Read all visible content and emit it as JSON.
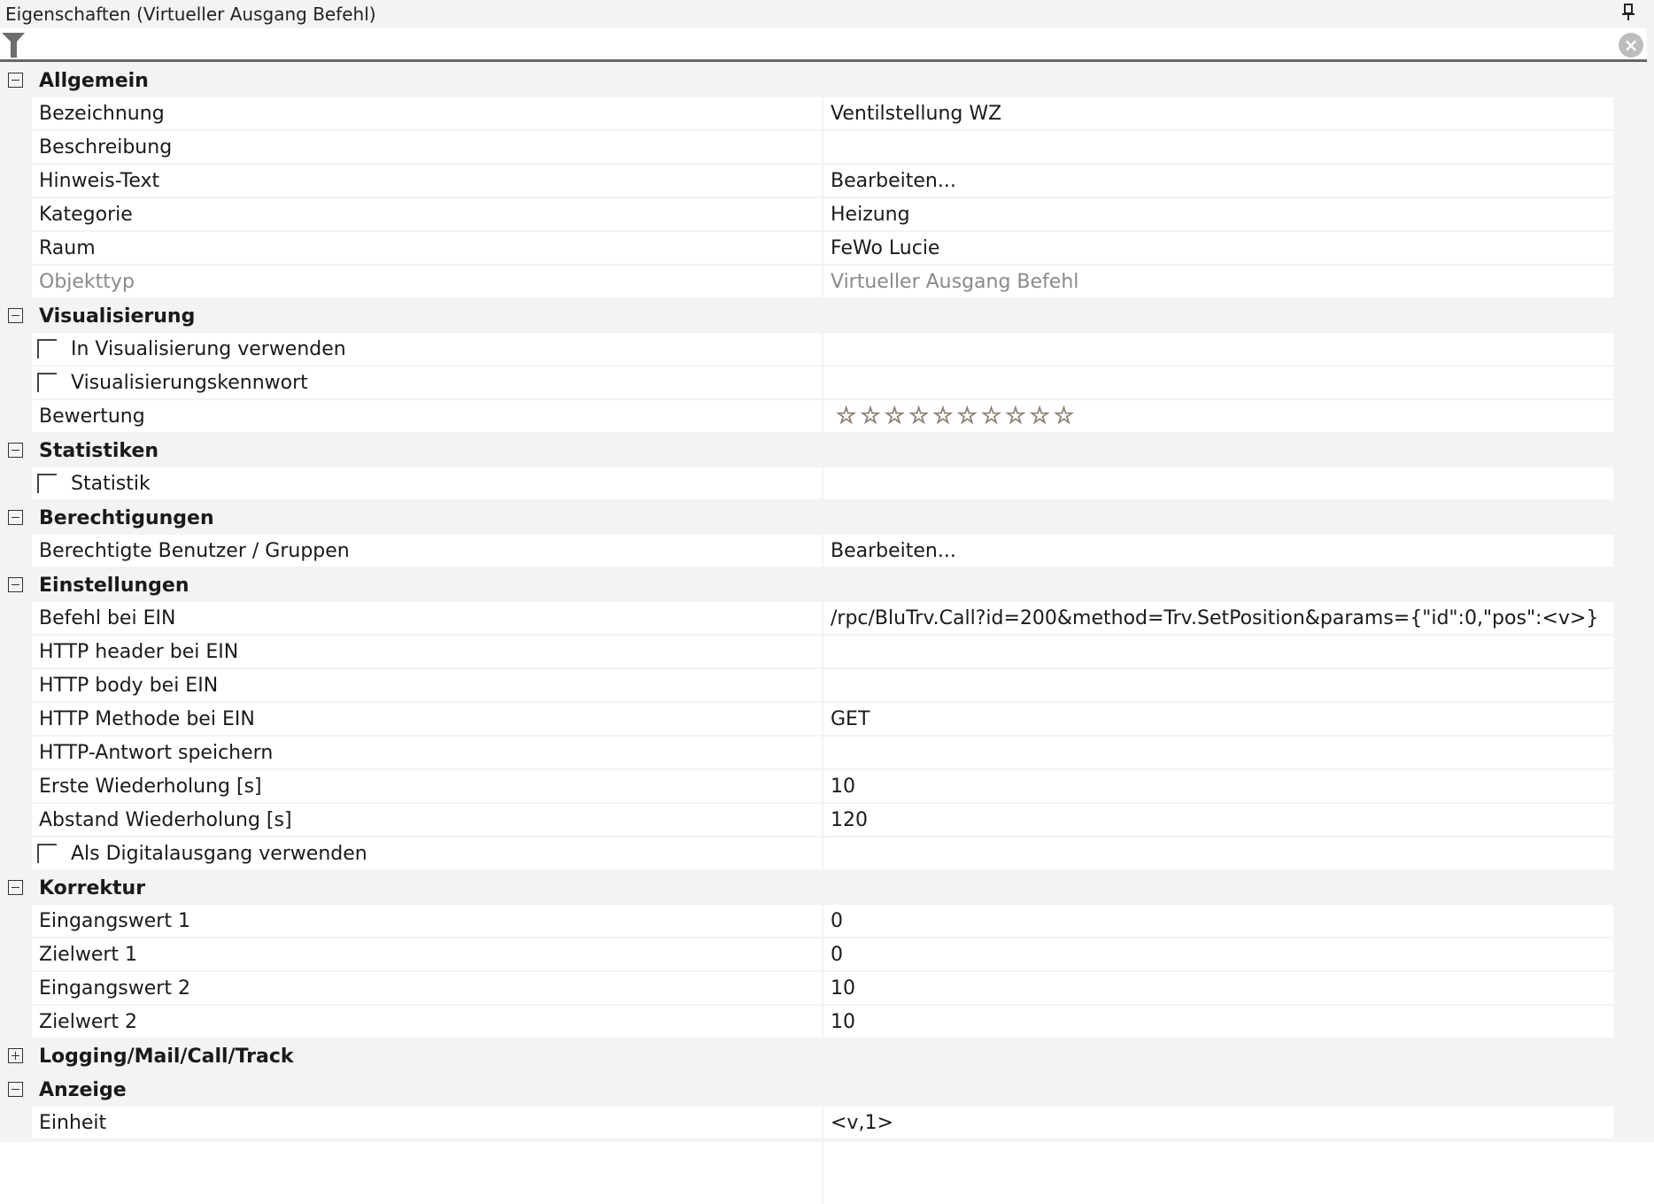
{
  "window": {
    "title": "Eigenschaften (Virtueller Ausgang Befehl)"
  },
  "filter": {
    "value": ""
  },
  "rows": [
    {
      "type": "cat",
      "label": "Allgemein",
      "expanded": true
    },
    {
      "type": "prop",
      "name": "Bezeichnung",
      "value": "Ventilstellung WZ"
    },
    {
      "type": "prop",
      "name": "Beschreibung",
      "value": ""
    },
    {
      "type": "prop",
      "name": "Hinweis-Text",
      "value": "Bearbeiten..."
    },
    {
      "type": "prop",
      "name": "Kategorie",
      "value": "Heizung"
    },
    {
      "type": "prop",
      "name": "Raum",
      "value": "FeWo Lucie"
    },
    {
      "type": "prop",
      "name": "Objekttyp",
      "value": "Virtueller Ausgang Befehl",
      "readonly": true
    },
    {
      "type": "cat",
      "label": "Visualisierung",
      "expanded": true
    },
    {
      "type": "check",
      "name": "In Visualisierung verwenden",
      "checked": false
    },
    {
      "type": "check",
      "name": "Visualisierungskennwort",
      "checked": false
    },
    {
      "type": "stars",
      "name": "Bewertung",
      "rating": 0,
      "max": 10
    },
    {
      "type": "cat",
      "label": "Statistiken",
      "expanded": true
    },
    {
      "type": "check",
      "name": "Statistik",
      "checked": false
    },
    {
      "type": "cat",
      "label": "Berechtigungen",
      "expanded": true
    },
    {
      "type": "prop",
      "name": "Berechtigte Benutzer / Gruppen",
      "value": "Bearbeiten..."
    },
    {
      "type": "cat",
      "label": "Einstellungen",
      "expanded": true
    },
    {
      "type": "prop",
      "name": "Befehl bei EIN",
      "value": "/rpc/BluTrv.Call?id=200&method=Trv.SetPosition&params={\"id\":0,\"pos\":<v>}"
    },
    {
      "type": "prop",
      "name": "HTTP header bei EIN",
      "value": ""
    },
    {
      "type": "prop",
      "name": "HTTP body bei EIN",
      "value": ""
    },
    {
      "type": "prop",
      "name": "HTTP Methode bei EIN",
      "value": "GET"
    },
    {
      "type": "prop",
      "name": "HTTP-Antwort speichern",
      "value": ""
    },
    {
      "type": "prop",
      "name": "Erste Wiederholung [s]",
      "value": "10"
    },
    {
      "type": "prop",
      "name": "Abstand Wiederholung [s]",
      "value": "120"
    },
    {
      "type": "check",
      "name": "Als Digitalausgang verwenden",
      "checked": false
    },
    {
      "type": "cat",
      "label": "Korrektur",
      "expanded": true
    },
    {
      "type": "prop",
      "name": "Eingangswert 1",
      "value": "0"
    },
    {
      "type": "prop",
      "name": "Zielwert 1",
      "value": "0"
    },
    {
      "type": "prop",
      "name": "Eingangswert 2",
      "value": "10"
    },
    {
      "type": "prop",
      "name": "Zielwert 2",
      "value": "10"
    },
    {
      "type": "cat",
      "label": "Logging/Mail/Call/Track",
      "expanded": false
    },
    {
      "type": "cat",
      "label": "Anzeige",
      "expanded": true
    },
    {
      "type": "prop",
      "name": "Einheit",
      "value": "<v,1>"
    }
  ]
}
